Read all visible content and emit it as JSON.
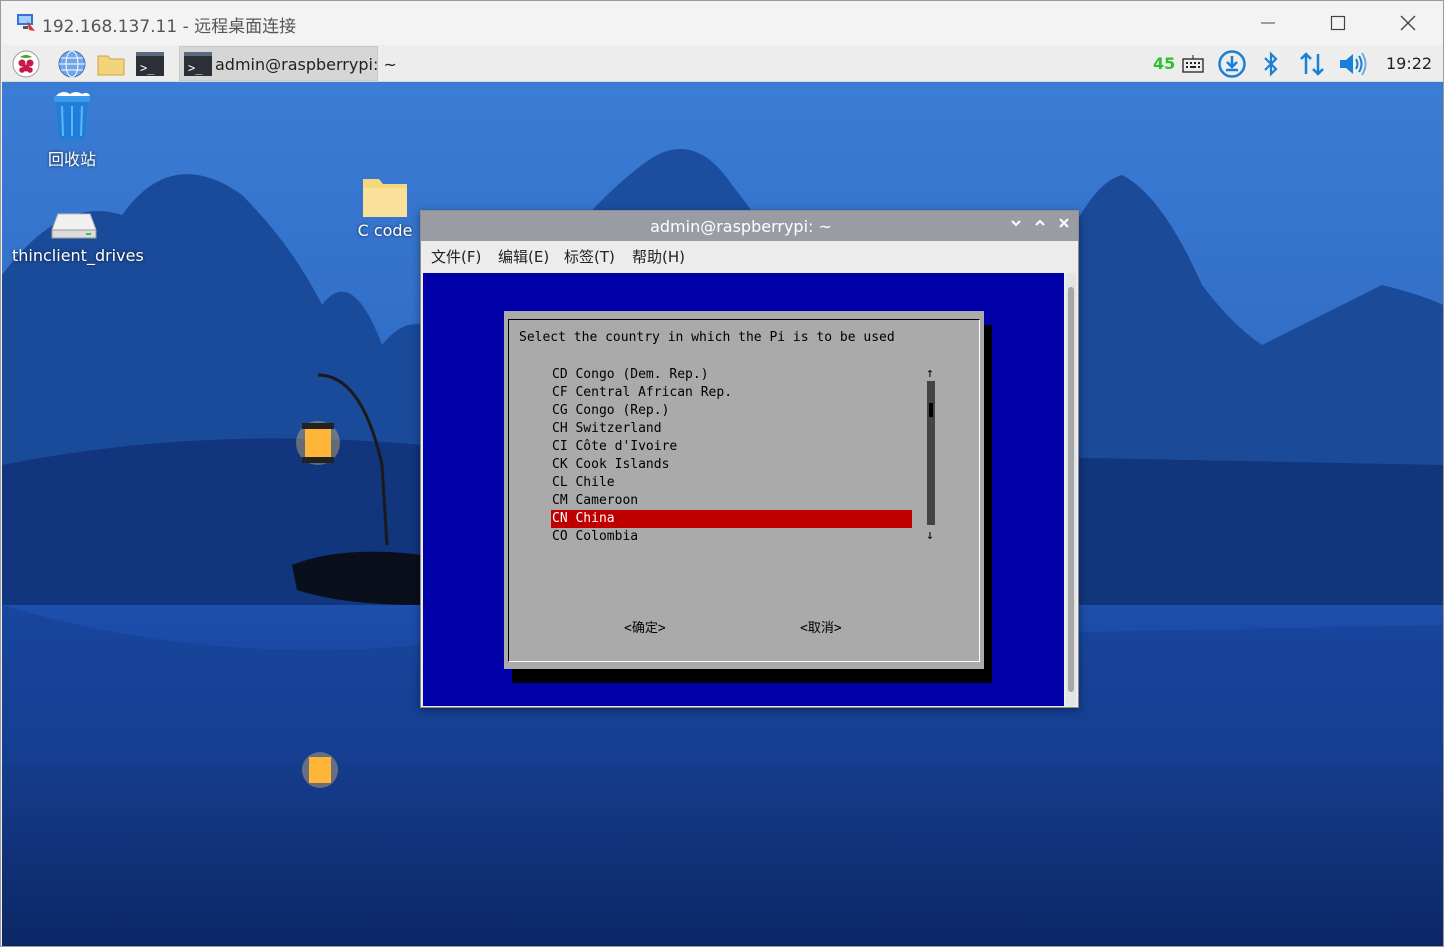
{
  "rdp": {
    "title": "192.168.137.11 - 远程桌面连接"
  },
  "taskbar": {
    "task_label": "admin@raspberrypi: ~",
    "tray_number": "45",
    "clock": "19:22"
  },
  "desktop": {
    "icons": [
      {
        "label": "回收站"
      },
      {
        "label": "thinclient_drives"
      },
      {
        "label": "C code"
      }
    ]
  },
  "terminal": {
    "title": "admin@raspberrypi: ~",
    "menu": [
      "文件(F)",
      "编辑(E)",
      "标签(T)",
      "帮助(H)"
    ],
    "dialog": {
      "prompt": "Select the country in which the Pi is to be used",
      "countries": [
        {
          "code": "CD",
          "name": "Congo (Dem. Rep.)"
        },
        {
          "code": "CF",
          "name": "Central African Rep."
        },
        {
          "code": "CG",
          "name": "Congo (Rep.)"
        },
        {
          "code": "CH",
          "name": "Switzerland"
        },
        {
          "code": "CI",
          "name": "Côte d'Ivoire"
        },
        {
          "code": "CK",
          "name": "Cook Islands"
        },
        {
          "code": "CL",
          "name": "Chile"
        },
        {
          "code": "CM",
          "name": "Cameroon"
        },
        {
          "code": "CN",
          "name": "China"
        },
        {
          "code": "CO",
          "name": "Colombia"
        }
      ],
      "selected_index": 8,
      "ok_label": "<确定>",
      "cancel_label": "<取消>",
      "scroll_up": "↑",
      "scroll_down": "↓"
    }
  },
  "colors": {
    "terminal_bg": "#0000a8",
    "dialog_bg": "#aaaaaa",
    "selection": "#c00000"
  }
}
